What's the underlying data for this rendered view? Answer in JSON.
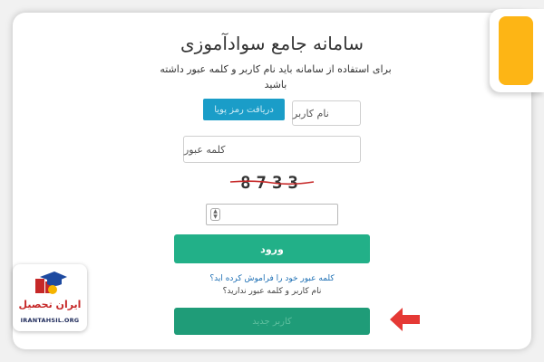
{
  "page": {
    "title": "سامانه جامع سوادآموزی",
    "subtitle": "برای استفاده از سامانه باید نام کاربر و کلمه عبور داشته باشید"
  },
  "form": {
    "otp_button_label": "دریافت رمز پویا",
    "username_placeholder": "نام کاربر",
    "password_placeholder": "کلمه عبور",
    "captcha_code": "8733",
    "captcha_input_value": "",
    "login_button_label": "ورود",
    "forgot_password_link": "کلمه عبور خود را فراموش کرده اید؟",
    "no_account_text": "نام کاربر و کلمه عبور ندارید؟",
    "register_button_label": "کاربر جدید"
  },
  "logo": {
    "brand_text": "ایران تحصیل",
    "site_text": "IRANTAHSIL.ORG"
  },
  "colors": {
    "login_button": "#22b088",
    "register_button": "#1f9c78",
    "otp_button": "#1a9dc8",
    "arrow": "#e53935",
    "corner_accent": "#fdb515",
    "link": "#1d6fb4"
  },
  "icons": {
    "arrow": "left-arrow-icon",
    "spinner": "number-spinner-icon",
    "logo": "graduation-cap-icon"
  }
}
